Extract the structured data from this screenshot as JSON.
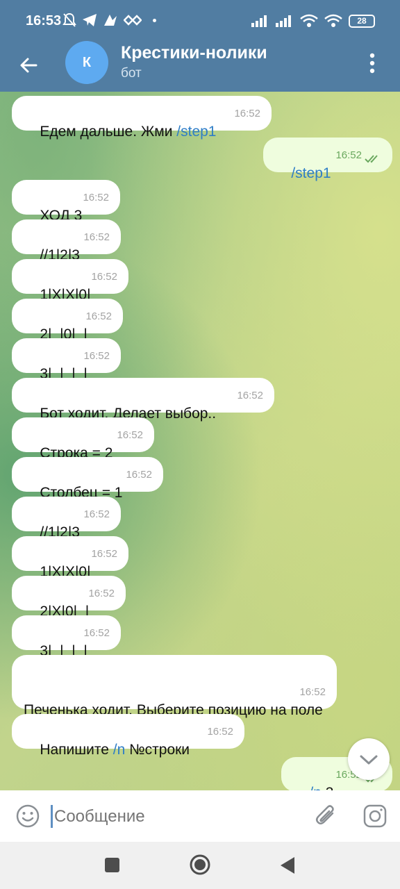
{
  "status": {
    "time": "16:53",
    "battery": "28"
  },
  "header": {
    "avatar_letter": "К",
    "title": "Крестики-нолики",
    "subtitle": "бот"
  },
  "messages": [
    {
      "dir": "in",
      "parts": [
        {
          "text": "Едем дальше. Жми "
        },
        {
          "text": "/step1",
          "cmd": true
        }
      ],
      "time": "16:52"
    },
    {
      "dir": "out",
      "parts": [
        {
          "text": "/step1",
          "cmd": true
        }
      ],
      "time": "16:52"
    },
    {
      "dir": "in",
      "parts": [
        {
          "text": "ХОД 3"
        }
      ],
      "time": "16:52"
    },
    {
      "dir": "in",
      "parts": [
        {
          "text": "//1|2|3"
        }
      ],
      "time": "16:52"
    },
    {
      "dir": "in",
      "parts": [
        {
          "text": "1|X|X|0|"
        }
      ],
      "time": "16:52"
    },
    {
      "dir": "in",
      "parts": [
        {
          "text": "2|_|0|_|"
        }
      ],
      "time": "16:52"
    },
    {
      "dir": "in",
      "parts": [
        {
          "text": "3|_|_|_|"
        }
      ],
      "time": "16:52"
    },
    {
      "dir": "in",
      "parts": [
        {
          "text": "Бот ходит. Делает выбор.."
        }
      ],
      "time": "16:52"
    },
    {
      "dir": "in",
      "parts": [
        {
          "text": "Строка = 2"
        }
      ],
      "time": "16:52"
    },
    {
      "dir": "in",
      "parts": [
        {
          "text": "Столбец = 1"
        }
      ],
      "time": "16:52"
    },
    {
      "dir": "in",
      "parts": [
        {
          "text": "//1|2|3"
        }
      ],
      "time": "16:52"
    },
    {
      "dir": "in",
      "parts": [
        {
          "text": "1|X|X|0|"
        }
      ],
      "time": "16:52"
    },
    {
      "dir": "in",
      "parts": [
        {
          "text": "2|X|0|_|"
        }
      ],
      "time": "16:52"
    },
    {
      "dir": "in",
      "parts": [
        {
          "text": "3|_|_|_|"
        }
      ],
      "time": "16:52"
    },
    {
      "dir": "in",
      "parts": [
        {
          "text": "Печенька ходит. Выберите позицию на поле"
        }
      ],
      "time": "16:52"
    },
    {
      "dir": "in",
      "parts": [
        {
          "text": "Напишите "
        },
        {
          "text": "/n",
          "cmd": true
        },
        {
          "text": " №строки"
        }
      ],
      "time": "16:52"
    },
    {
      "dir": "out",
      "parts": [
        {
          "text": "/n",
          "cmd": true
        },
        {
          "text": " 3"
        }
      ],
      "time": "16:52"
    }
  ],
  "composer": {
    "placeholder": "Сообщение"
  },
  "colors": {
    "header_bg": "#517da2",
    "outgoing_bubble": "#effdde",
    "command_link": "#2f7ec6"
  },
  "icons": [
    "back-arrow-icon",
    "menu-dots-icon",
    "emoji-icon",
    "attach-icon",
    "camera-icon",
    "chevron-down-icon",
    "double-check-icon"
  ]
}
